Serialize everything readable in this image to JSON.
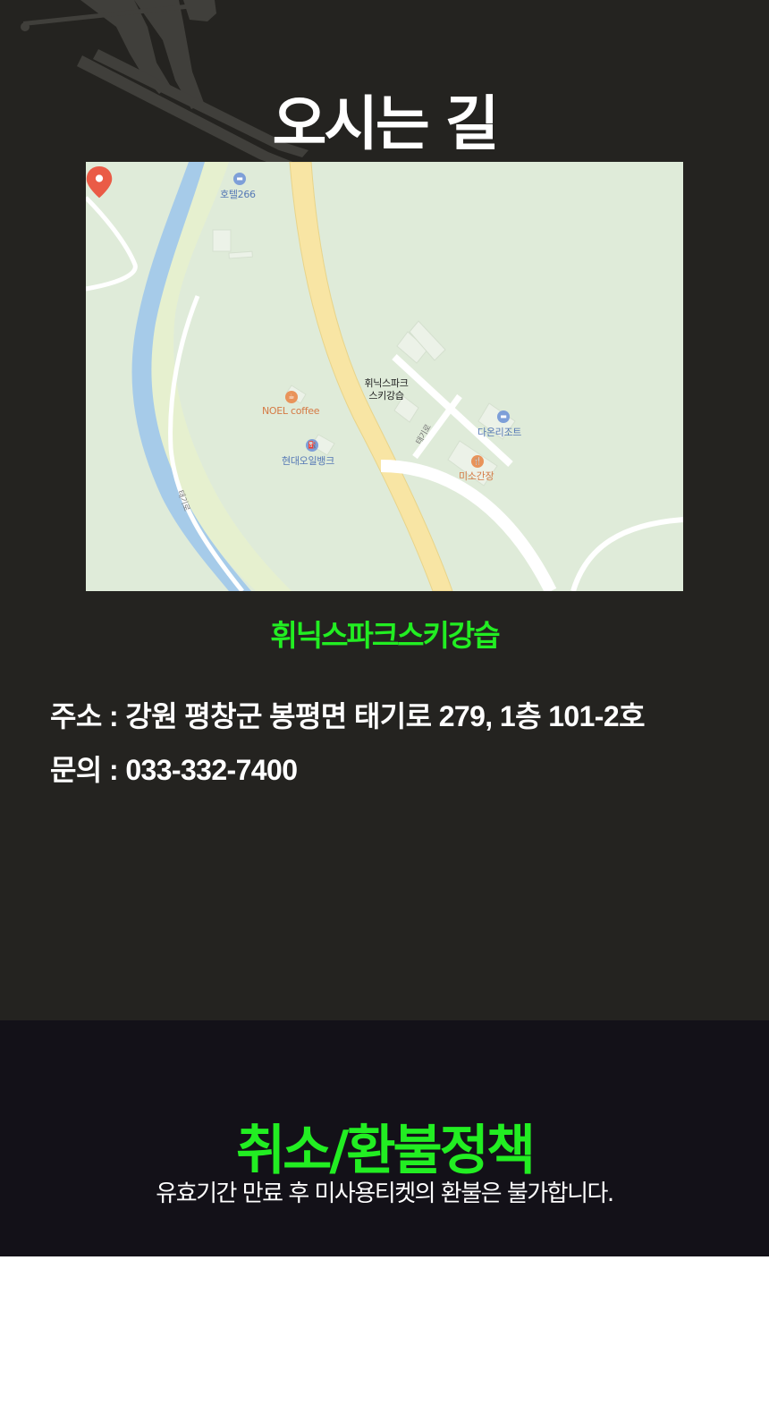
{
  "directions": {
    "title": "오시는 길",
    "map": {
      "labels": {
        "hotel": "호텔266",
        "pin_line1": "휘닉스파크",
        "pin_line2": "스키강습",
        "noel": "NOEL coffee",
        "oilbank": "현대오일뱅크",
        "daon": "다온리조트",
        "miso": "미소간장",
        "road1": "태기로",
        "road2": "태기로"
      },
      "colors": {
        "background": "#dfebd9",
        "river": "#a6cbe9",
        "main_road": "#f8e5a4",
        "road": "#ffffff",
        "pin": "#ea5b46"
      }
    },
    "place_name": "휘닉스파크스키강습",
    "address": "주소 : 강원 평창군 봉평면 태기로 279, 1층 101-2호",
    "phone": "문의 : 033-332-7400"
  },
  "refund": {
    "title": "취소/환불정책",
    "text": "유효기간 만료 후 미사용티켓의 환불은 불가합니다."
  },
  "theme": {
    "accent": "#22ee22",
    "dark_bg": "#242320",
    "refund_bg": "#131118",
    "text": "#ffffff"
  }
}
